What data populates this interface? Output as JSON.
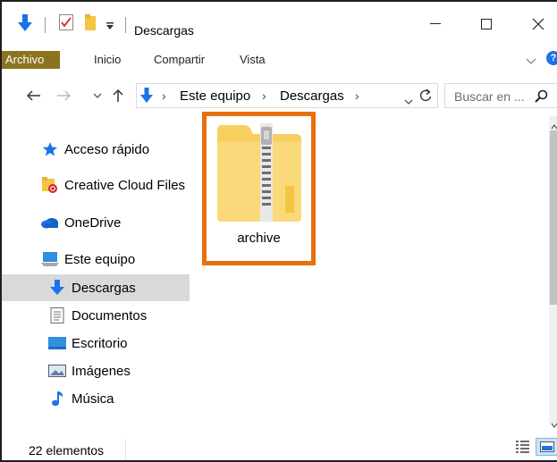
{
  "window": {
    "title": "Descargas",
    "controls": {
      "minimize": "—",
      "maximize": "☐",
      "close": "✕"
    }
  },
  "ribbon": {
    "tabs": [
      {
        "label": "Archivo"
      },
      {
        "label": "Inicio"
      },
      {
        "label": "Compartir"
      },
      {
        "label": "Vista"
      }
    ],
    "help": "?"
  },
  "address": {
    "breadcrumbs": [
      "Este equipo",
      "Descargas"
    ],
    "search_placeholder": "Buscar en ..."
  },
  "nav_pane": {
    "items": [
      {
        "label": "Acceso rápido",
        "icon": "star-icon"
      },
      {
        "label": "Creative Cloud Files",
        "icon": "creative-cloud-folder-icon"
      },
      {
        "label": "OneDrive",
        "icon": "onedrive-cloud-icon"
      },
      {
        "label": "Este equipo",
        "icon": "computer-icon"
      },
      {
        "label": "Descargas",
        "icon": "download-arrow-icon",
        "selected": true
      },
      {
        "label": "Documentos",
        "icon": "document-icon"
      },
      {
        "label": "Escritorio",
        "icon": "desktop-icon"
      },
      {
        "label": "Imágenes",
        "icon": "pictures-icon"
      },
      {
        "label": "Música",
        "icon": "music-note-icon"
      }
    ]
  },
  "content": {
    "items": [
      {
        "name": "archive",
        "icon": "zip-folder-icon",
        "highlighted": true
      }
    ]
  },
  "status": {
    "count_text": "22 elementos"
  },
  "colors": {
    "file_tab": "#8b7320",
    "highlight": "#e8700c",
    "selection": "#d9d9d9",
    "accent_blue": "#1a73e8"
  }
}
